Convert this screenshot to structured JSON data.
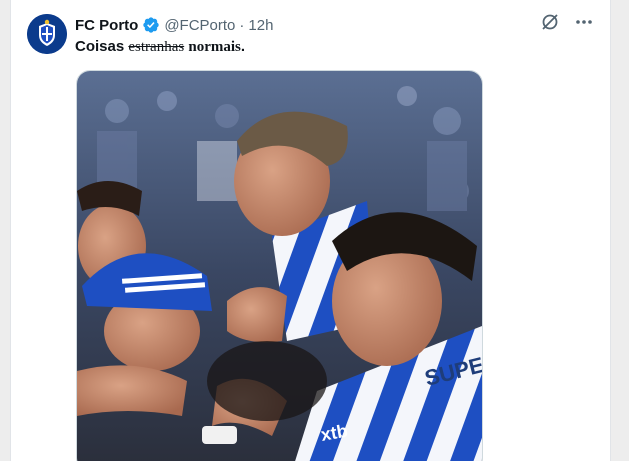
{
  "tweet": {
    "author_name": "FC Porto",
    "handle": "@FCPorto",
    "separator": "·",
    "time": "12h",
    "text_part1": "Coisas",
    "text_struck": "estranhas",
    "text_part2": "normais",
    "text_end": "."
  },
  "image": {
    "jersey_text_1": "SUPER",
    "jersey_text_2": "xtb"
  },
  "colors": {
    "verified_blue": "#1d9bf0",
    "porto_blue": "#1e4fc2",
    "text_secondary": "#536471"
  },
  "icons": {
    "verified": "verified-badge-icon",
    "grok": "grok-icon",
    "more": "more-icon"
  }
}
